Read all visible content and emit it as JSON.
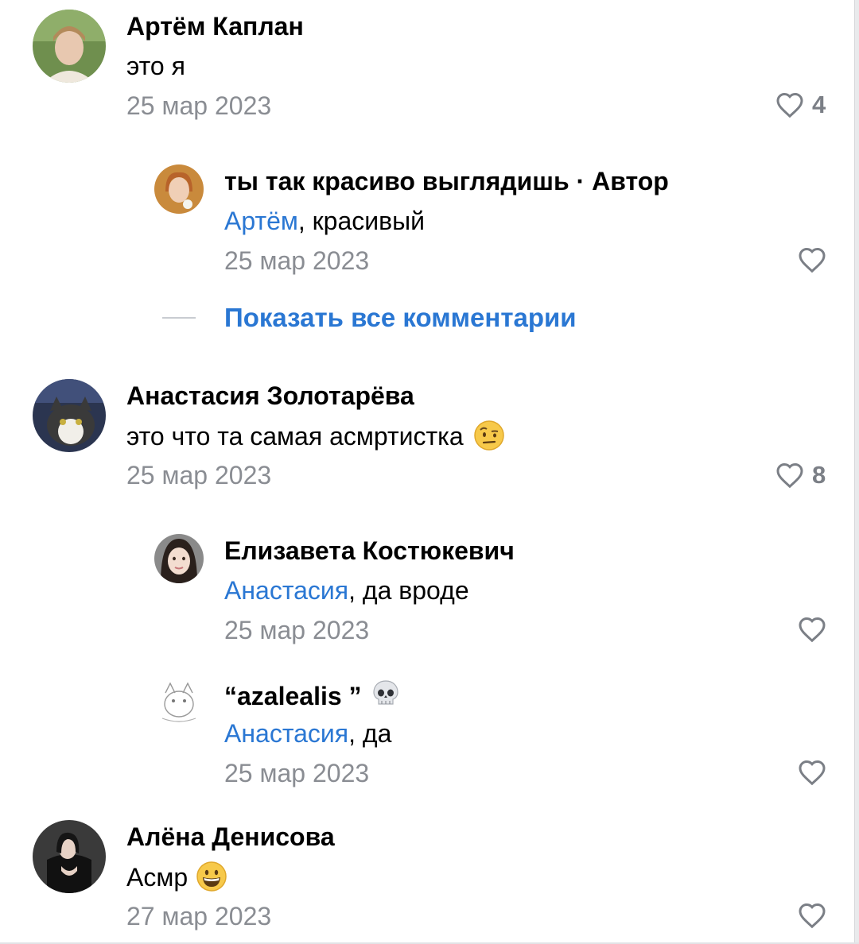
{
  "comments": [
    {
      "name": "Артём Каплан",
      "text": "это я",
      "date": "25 мар 2023",
      "likes": "4",
      "replies": [
        {
          "name": "ты так красиво выглядишь",
          "author_badge": " · Автор",
          "mention": "Артём",
          "text": ", красивый",
          "date": "25 мар 2023"
        }
      ]
    },
    {
      "name": "Анастасия Золотарёва",
      "text": "это что та самая асмртистка",
      "emoji": "face-with-raised-eyebrow",
      "date": "25 мар 2023",
      "likes": "8",
      "replies": [
        {
          "name": "Елизавета Костюкевич",
          "mention": "Анастасия",
          "text": ", да вроде",
          "date": "25 мар 2023"
        },
        {
          "name": "“azalealis ”",
          "name_emoji": "skull",
          "mention": "Анастасия",
          "text": ", да",
          "date": "25 мар 2023"
        }
      ]
    },
    {
      "name": "Алёна Денисова",
      "text": "Асмр",
      "emoji": "grinning-face",
      "date": "27 мар 2023"
    }
  ],
  "show_all_label": "Показать все комментарии",
  "colors": {
    "link": "#2a77d3",
    "meta": "#8a8d93",
    "icon": "#7b7f86"
  }
}
